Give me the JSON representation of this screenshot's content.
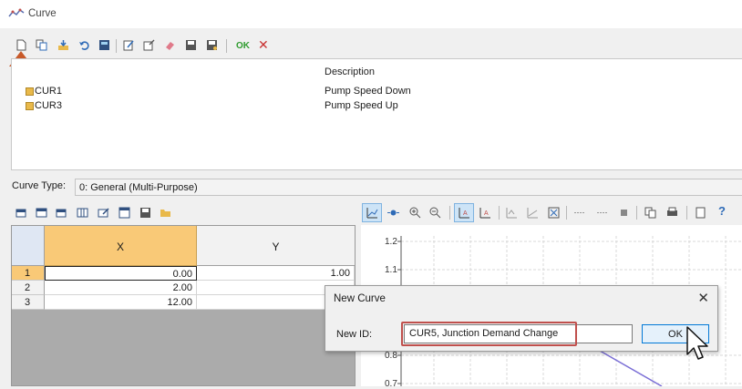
{
  "window": {
    "title": "Curve"
  },
  "toolbar": {
    "ok_label": "OK",
    "cancel_glyph": "✕"
  },
  "list": {
    "header_description": "Description",
    "rows": [
      {
        "name": "CUR1",
        "description": "Pump Speed Down"
      },
      {
        "name": "CUR3",
        "description": "Pump Speed Up"
      }
    ]
  },
  "curve_type": {
    "label": "Curve Type:",
    "value": "0: General (Multi-Purpose)"
  },
  "grid": {
    "columns": [
      "X",
      "Y"
    ],
    "rows": [
      {
        "index": "1",
        "x": "0.00",
        "y": "1.00"
      },
      {
        "index": "2",
        "x": "2.00",
        "y": ""
      },
      {
        "index": "3",
        "x": "12.00",
        "y": ""
      }
    ]
  },
  "chart": {
    "help_glyph": "?",
    "y_ticks": [
      "1.2",
      "1.1",
      "0.8",
      "0.7"
    ]
  },
  "dialog": {
    "title": "New Curve",
    "close_glyph": "✕",
    "id_label": "New ID:",
    "id_value": "CUR5, Junction Demand Change",
    "ok_label": "OK"
  },
  "colors": {
    "annotation": "#c0504d",
    "header_selected": "#f9c977",
    "accent": "#0078d7"
  },
  "icons": [
    "curve-app-icon",
    "new-icon",
    "copy-icon",
    "import-icon",
    "undo-icon",
    "calc-icon",
    "edit-icon",
    "rename-icon",
    "erase-icon",
    "save-icon",
    "save-as-icon",
    "ok-icon",
    "cancel-icon",
    "mouse-cursor-icon",
    "annotation-arrow-icon"
  ]
}
